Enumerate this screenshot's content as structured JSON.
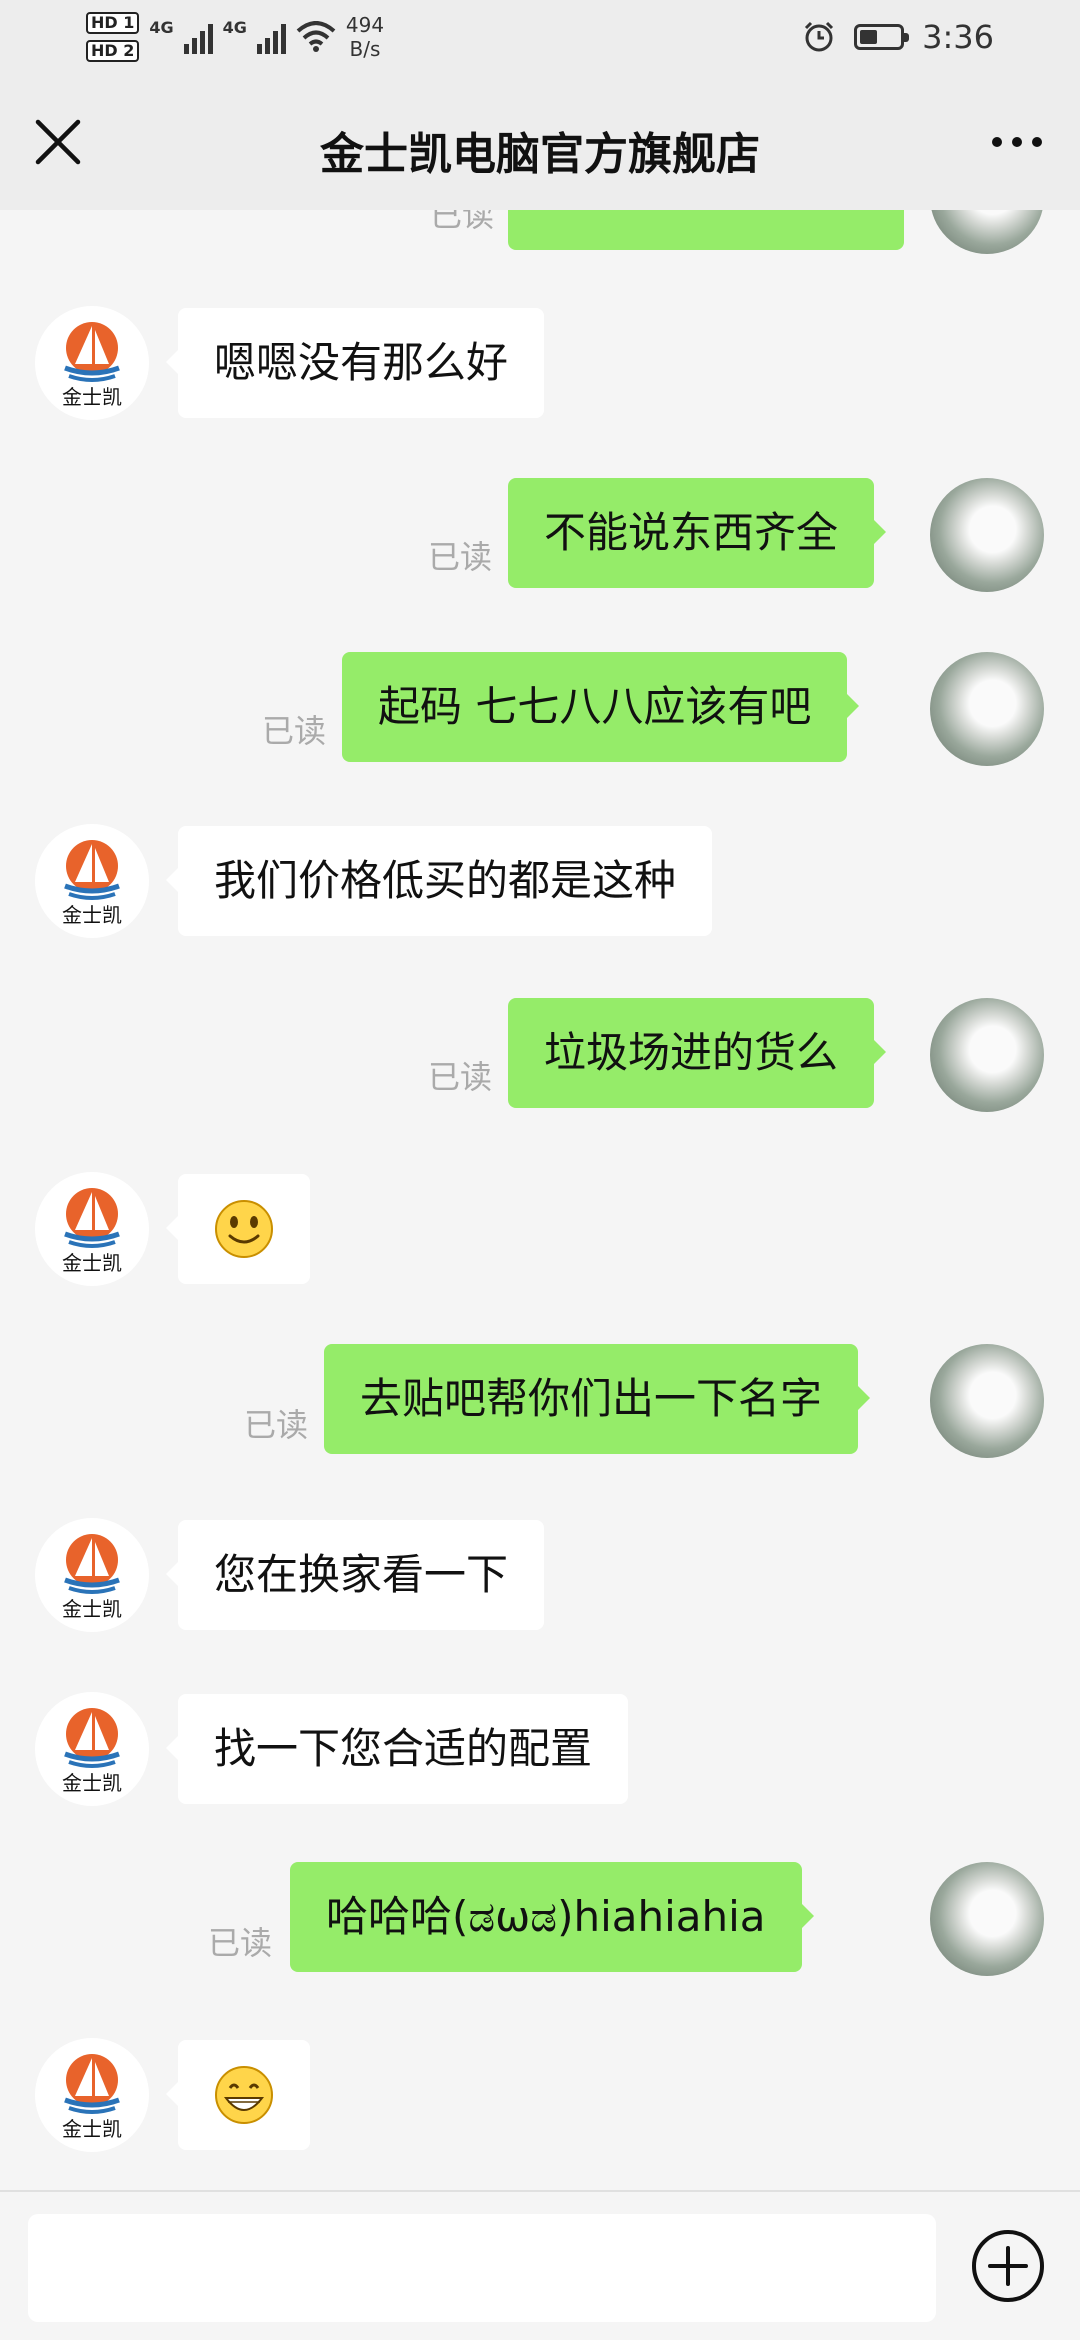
{
  "status_bar": {
    "network_badges": [
      "HD 1",
      "HD 2"
    ],
    "network_type_1": "4G",
    "network_type_2": "4G",
    "speed_value": "494",
    "speed_unit": "B/s",
    "time": "3:36",
    "battery_level": 0.45,
    "icons": [
      "signal-icon",
      "wifi-icon",
      "alarm-icon",
      "battery-icon"
    ]
  },
  "header": {
    "title": "金士凯电脑官方旗舰店",
    "close_icon": "close-icon",
    "more_icon": "more-icon"
  },
  "shop_avatar_text": "金士凯",
  "read_label": "已读",
  "messages": [
    {
      "side": "right",
      "text": "",
      "partial": true
    },
    {
      "side": "left",
      "text": "嗯嗯没有那么好"
    },
    {
      "side": "right",
      "text": "不能说东西齐全",
      "read": true
    },
    {
      "side": "right",
      "text": "起码  七七八八应该有吧",
      "read": true
    },
    {
      "side": "left",
      "text": "我们价格低买的都是这种"
    },
    {
      "side": "right",
      "text": "垃圾场进的货么",
      "read": true
    },
    {
      "side": "left",
      "emoji": "smile-emoji"
    },
    {
      "side": "right",
      "text": "去贴吧帮你们出一下名字",
      "read": true
    },
    {
      "side": "left",
      "text": "您在换家看一下"
    },
    {
      "side": "left",
      "text": "找一下您合适的配置"
    },
    {
      "side": "right",
      "text": "哈哈哈(ಡωಡ)hiahiahia",
      "read": true
    },
    {
      "side": "left",
      "emoji": "grin-emoji"
    }
  ],
  "input": {
    "value": "",
    "add_icon": "plus-circle-icon"
  },
  "colors": {
    "header_bg": "#ededed",
    "chat_bg": "#f5f5f5",
    "bubble_right": "#95ec69",
    "bubble_left": "#ffffff",
    "read_text": "#aaaaaa"
  }
}
